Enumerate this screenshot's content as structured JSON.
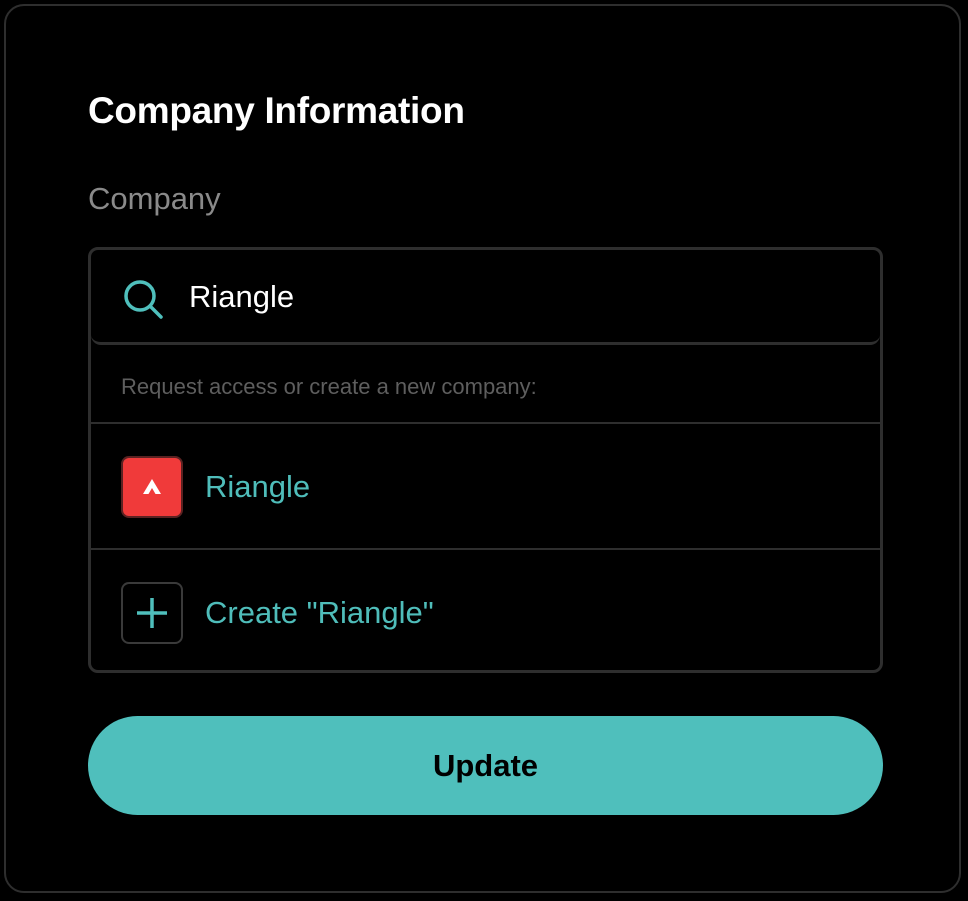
{
  "form": {
    "title": "Company Information",
    "company_label": "Company"
  },
  "search": {
    "value": "Riangle",
    "icon": "search-icon"
  },
  "dropdown": {
    "hint": "Request access or create a new company:",
    "options": [
      {
        "label": "Riangle",
        "icon": "company-logo-icon"
      },
      {
        "label": "Create \"Riangle\"",
        "icon": "plus-icon"
      }
    ]
  },
  "actions": {
    "update_label": "Update"
  },
  "colors": {
    "accent": "#4fbfbc",
    "logo_red": "#f03a3a",
    "border": "#2e2e2e",
    "muted_text": "#8a8a8a"
  }
}
